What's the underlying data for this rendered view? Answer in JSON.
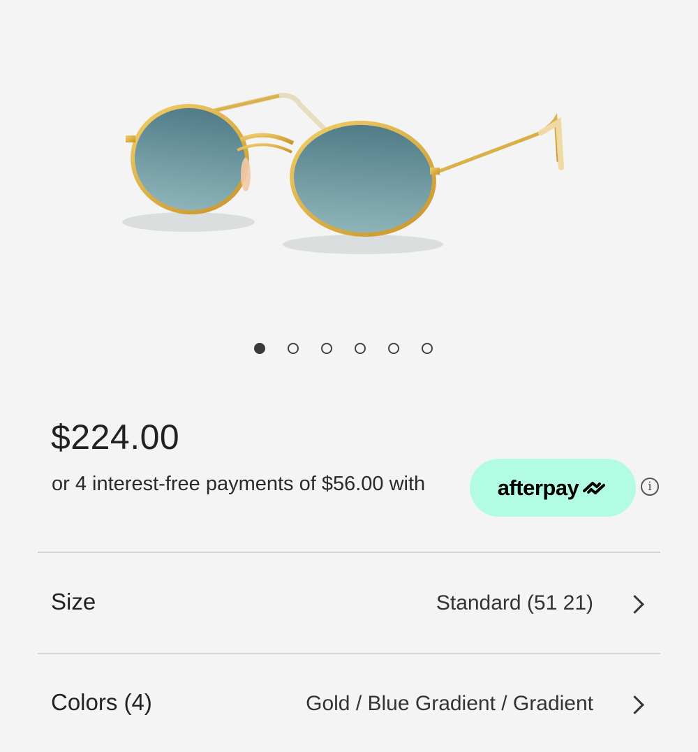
{
  "gallery": {
    "image_alt": "Oval gold-frame sunglasses with blue gradient lenses",
    "dot_count": 6,
    "active_index": 0
  },
  "pricing": {
    "price": "$224.00",
    "installment_text": "or 4 interest-free payments of $56.00 with",
    "afterpay_label": "afterpay",
    "afterpay_color": "#b2fce4",
    "info_glyph": "i"
  },
  "options": [
    {
      "label": "Size",
      "value": "Standard (51 21)"
    },
    {
      "label": "Colors (4)",
      "value": "Gold / Blue Gradient / Gradient"
    }
  ],
  "colors": {
    "background": "#f4f4f4",
    "frame_gold": "#d7a93a",
    "lens_blue": "#5d8590",
    "divider": "#d4d4d4"
  }
}
